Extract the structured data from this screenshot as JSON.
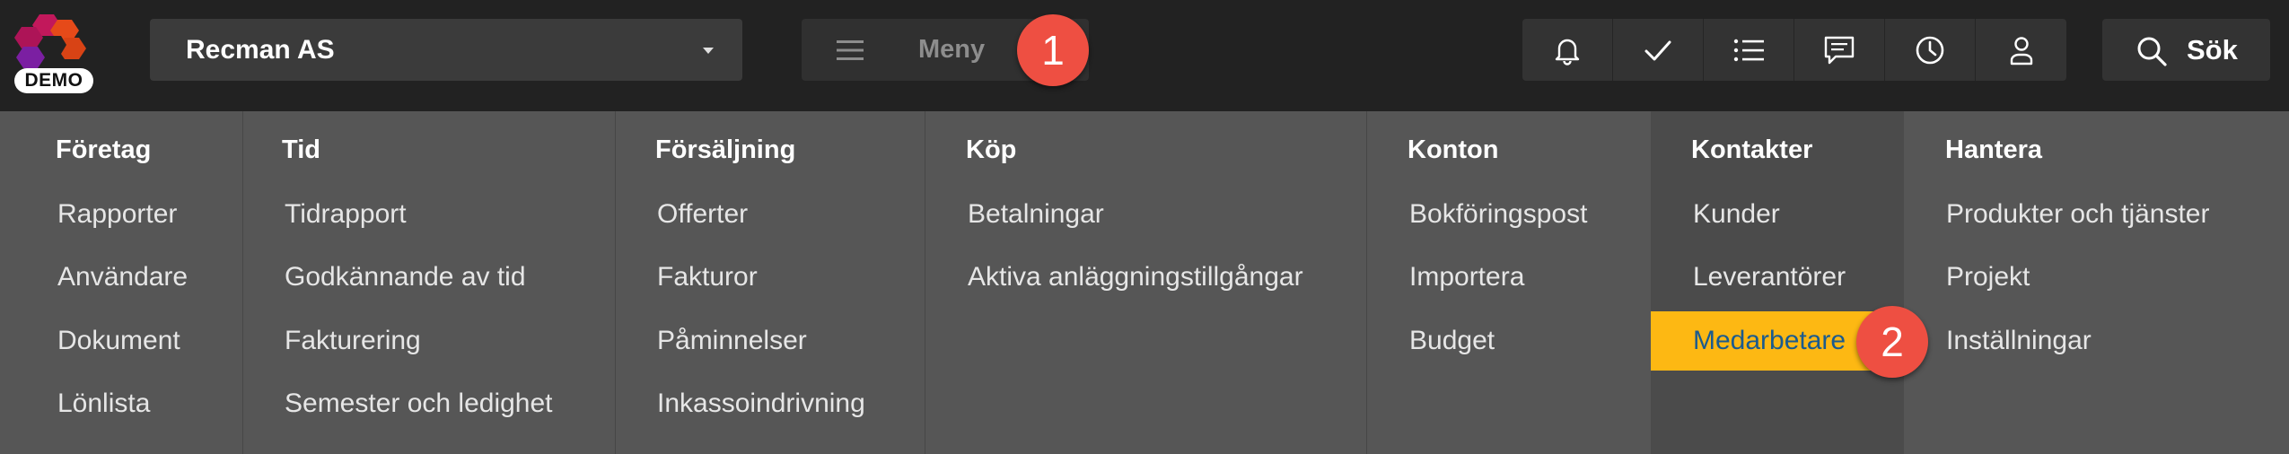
{
  "logo": {
    "badge": "DEMO",
    "colors": [
      "#c2185b",
      "#e64a19",
      "#7b1fa2"
    ]
  },
  "company": {
    "name": "Recman AS"
  },
  "menu": {
    "label": "Meny"
  },
  "steps": {
    "one": "1",
    "two": "2"
  },
  "toolbar": {
    "icons": [
      "bell-icon",
      "check-icon",
      "list-icon",
      "chat-icon",
      "clock-icon",
      "user-icon"
    ]
  },
  "search": {
    "label": "Sök"
  },
  "mega_menu": {
    "columns": [
      {
        "title": "Företag",
        "items": [
          "Rapporter",
          "Användare",
          "Dokument",
          "Lönlista"
        ]
      },
      {
        "title": "Tid",
        "items": [
          "Tidrapport",
          "Godkännande av tid",
          "Fakturering",
          "Semester och ledighet"
        ]
      },
      {
        "title": "Försäljning",
        "items": [
          "Offerter",
          "Fakturor",
          "Påminnelser",
          "Inkassoindrivning"
        ]
      },
      {
        "title": "Köp",
        "items": [
          "Betalningar",
          "Aktiva anläggningstillgångar"
        ]
      },
      {
        "title": "Konton",
        "items": [
          "Bokföringspost",
          "Importera",
          "Budget"
        ]
      },
      {
        "title": "Kontakter",
        "items": [
          "Kunder",
          "Leverantörer",
          "Medarbetare"
        ]
      },
      {
        "title": "Hantera",
        "items": [
          "Produkter och tjänster",
          "Projekt",
          "Inställningar"
        ]
      }
    ]
  },
  "colors": {
    "topbar": "#222222",
    "menu_bg": "#565656",
    "accent_highlight": "#fdb813",
    "active_text": "#1b5b8e",
    "badge": "#ee4f42"
  }
}
